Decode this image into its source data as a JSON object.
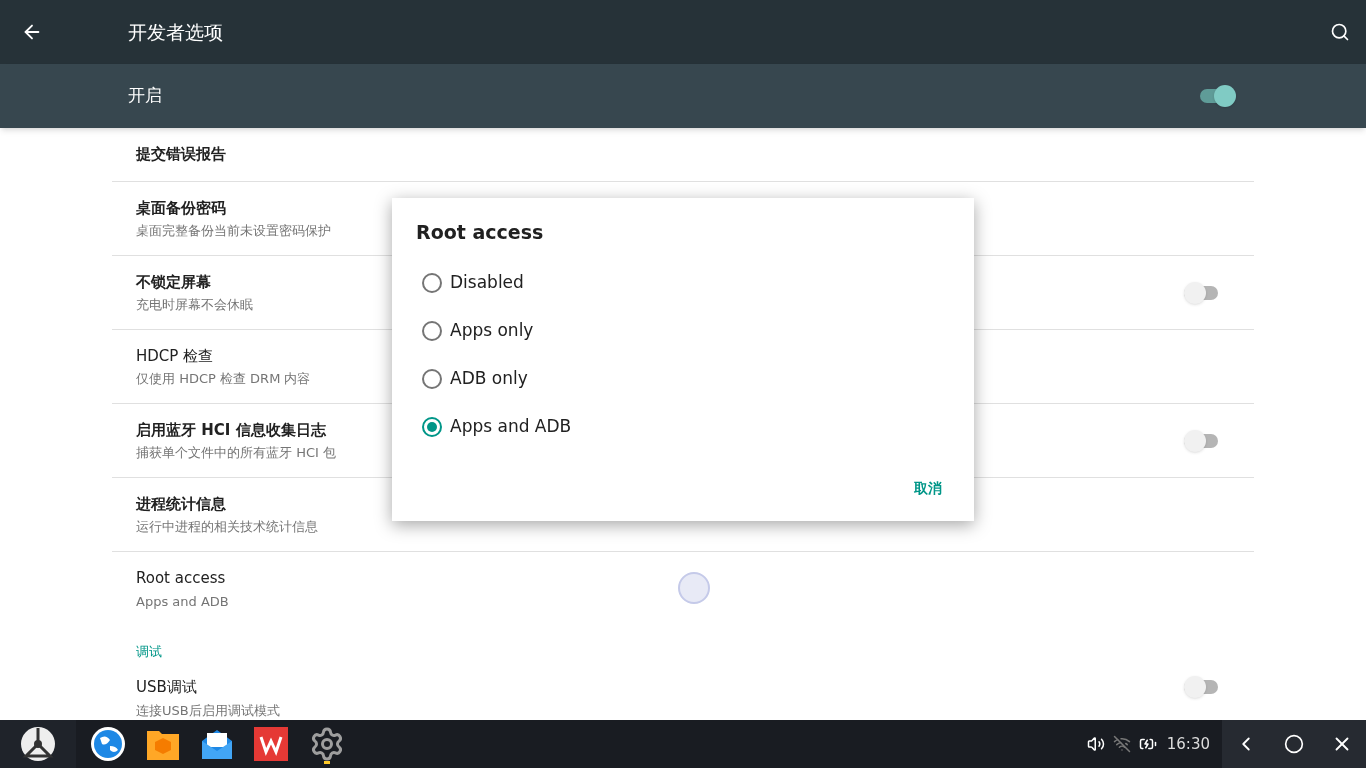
{
  "app_bar": {
    "title": "开发者选项"
  },
  "master_switch": {
    "label": "开启",
    "on": true
  },
  "items": [
    {
      "kind": "plain",
      "title": "提交错误报告",
      "bold": true
    },
    {
      "kind": "plain",
      "title": "桌面备份密码",
      "subtitle": "桌面完整备份当前未设置密码保护",
      "bold": true
    },
    {
      "kind": "switch",
      "title": "不锁定屏幕",
      "subtitle": "充电时屏幕不会休眠",
      "bold": true,
      "on": false
    },
    {
      "kind": "plain",
      "title": "HDCP 检查",
      "subtitle": "仅使用 HDCP 检查 DRM 内容",
      "bold": false
    },
    {
      "kind": "switch",
      "title": "启用蓝牙 HCI 信息收集日志",
      "subtitle": "捕获单个文件中的所有蓝牙 HCI 包",
      "bold": true,
      "on": false
    },
    {
      "kind": "plain",
      "title": "进程统计信息",
      "subtitle": "运行中进程的相关技术统计信息",
      "bold": true
    },
    {
      "kind": "plain",
      "title": "Root access",
      "subtitle": "Apps and ADB",
      "bold": false
    },
    {
      "kind": "header",
      "title": "调试"
    },
    {
      "kind": "switch",
      "title": "USB调试",
      "subtitle": "连接USB后启用调试模式",
      "bold": false,
      "on": false
    }
  ],
  "dialog": {
    "title": "Root access",
    "options": [
      {
        "label": "Disabled",
        "selected": false
      },
      {
        "label": "Apps only",
        "selected": false
      },
      {
        "label": "ADB only",
        "selected": false
      },
      {
        "label": "Apps and ADB",
        "selected": true
      }
    ],
    "cancel": "取消"
  },
  "taskbar": {
    "time": "16:30"
  }
}
